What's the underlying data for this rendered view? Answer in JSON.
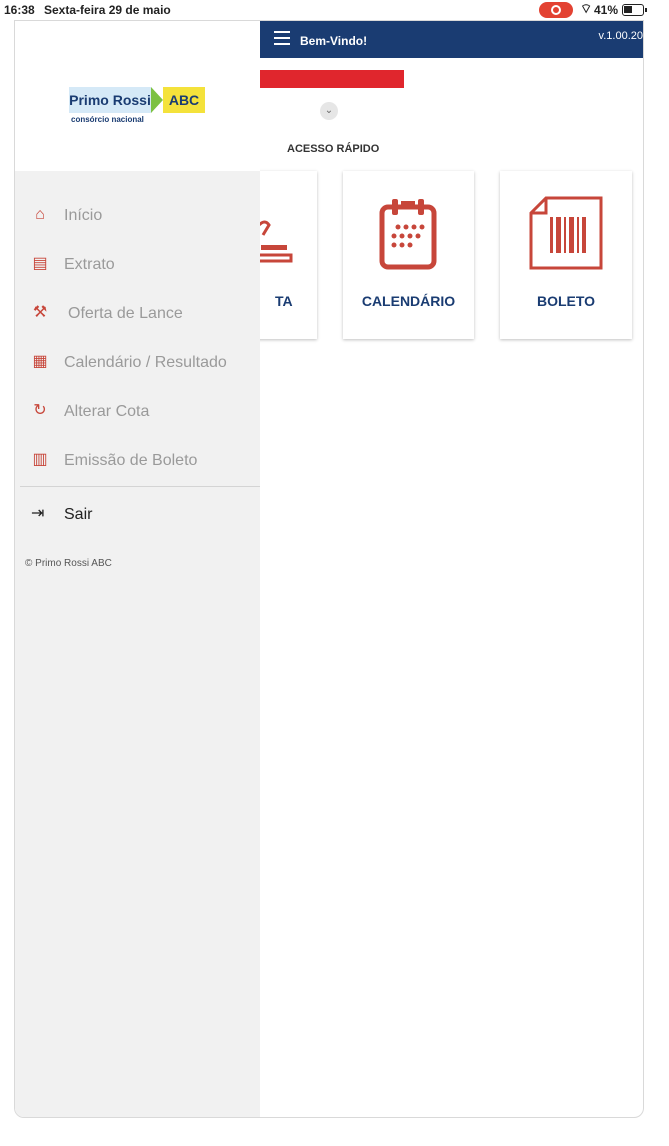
{
  "status_bar": {
    "time": "16:38",
    "date": "Sexta-feira 29 de maio",
    "battery_percent": "41%"
  },
  "header": {
    "title": "Bem-Vindo!",
    "version": "v.1.00.20",
    "background": "#1a3c72"
  },
  "quick_access": {
    "title": "ACESSO RÁPIDO",
    "cards": [
      {
        "label": "TA",
        "icon": "gavel-icon"
      },
      {
        "label": "CALENDÁRIO",
        "icon": "calendar-icon"
      },
      {
        "label": "BOLETO",
        "icon": "barcode-document-icon"
      }
    ]
  },
  "logo": {
    "name_part1": "Primo Rossi",
    "name_part2": "ABC",
    "tagline": "consórcio nacional"
  },
  "drawer": {
    "items": [
      {
        "label": "Início",
        "icon": "home-icon"
      },
      {
        "label": "Extrato",
        "icon": "document-icon"
      },
      {
        "label": "Oferta de Lance",
        "icon": "gavel-icon"
      },
      {
        "label": "Calendário / Resultado",
        "icon": "calendar-icon"
      },
      {
        "label": "Alterar Cota",
        "icon": "refresh-icon"
      },
      {
        "label": "Emissão de Boleto",
        "icon": "barcode-icon"
      }
    ],
    "logout_label": "Sair",
    "copyright": "© Primo Rossi ABC"
  },
  "colors": {
    "accent_red": "#c7463a",
    "alert_red": "#e0262d",
    "brand_blue": "#1a3c72"
  }
}
